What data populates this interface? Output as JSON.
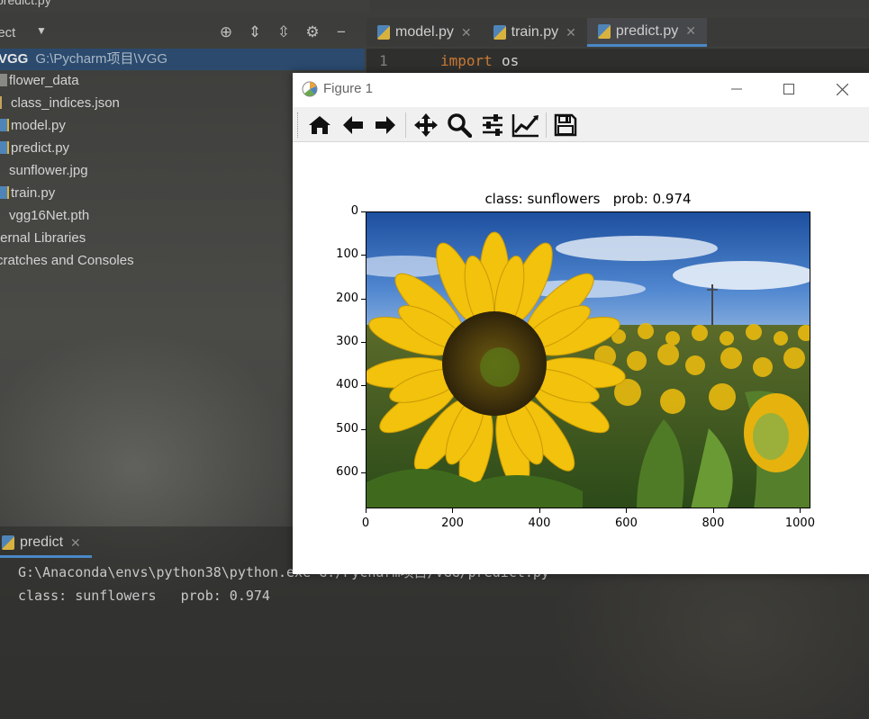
{
  "ide": {
    "window_title": "predict.py",
    "project_label": "ject",
    "root": {
      "name": "VGG",
      "path": "G:\\Pycharm项目\\VGG"
    },
    "tree_items": [
      {
        "label": "flower_data",
        "icon": "folder-icon"
      },
      {
        "label": "class_indices.json",
        "icon": "json-file-icon"
      },
      {
        "label": "model.py",
        "icon": "python-file-icon"
      },
      {
        "label": "predict.py",
        "icon": "python-file-icon"
      },
      {
        "label": "sunflower.jpg",
        "icon": "image-file-icon"
      },
      {
        "label": "train.py",
        "icon": "python-file-icon"
      },
      {
        "label": "vgg16Net.pth",
        "icon": "file-icon"
      },
      {
        "label": "ternal Libraries",
        "icon": "library-icon"
      },
      {
        "label": "cratches and Consoles",
        "icon": "scratch-icon"
      }
    ],
    "editor_tabs": [
      {
        "label": "model.py",
        "active": false
      },
      {
        "label": "train.py",
        "active": false
      },
      {
        "label": "predict.py",
        "active": true
      }
    ],
    "editor": {
      "line_number": "1",
      "keyword": "import",
      "module": "os"
    },
    "run": {
      "tab_label": "predict",
      "console_lines": [
        "G:\\Anaconda\\envs\\python38\\python.exe G:/Pycharm项目/VGG/predict.py",
        "class: sunflowers   prob: 0.974"
      ]
    },
    "colors": {
      "accent": "#4a88c7",
      "keyword": "#cc7832",
      "selection": "#2b4a6e"
    }
  },
  "figure": {
    "window_title": "Figure 1",
    "toolbar": [
      "home-icon",
      "back-icon",
      "forward-icon",
      "pan-icon",
      "zoom-icon",
      "configure-subplots-icon",
      "edit-axis-icon",
      "save-icon"
    ],
    "plot_title": "class: sunflowers   prob: 0.974",
    "image_description": "sunflower.jpg"
  },
  "chart_data": {
    "type": "image",
    "title": "class: sunflowers   prob: 0.974",
    "xlabel": "",
    "ylabel": "",
    "xlim": [
      0,
      1024
    ],
    "ylim": [
      683,
      0
    ],
    "xticks": [
      "0",
      "200",
      "400",
      "600",
      "800",
      "1000"
    ],
    "yticks": [
      "0",
      "100",
      "200",
      "300",
      "400",
      "500",
      "600"
    ],
    "grid": false
  }
}
